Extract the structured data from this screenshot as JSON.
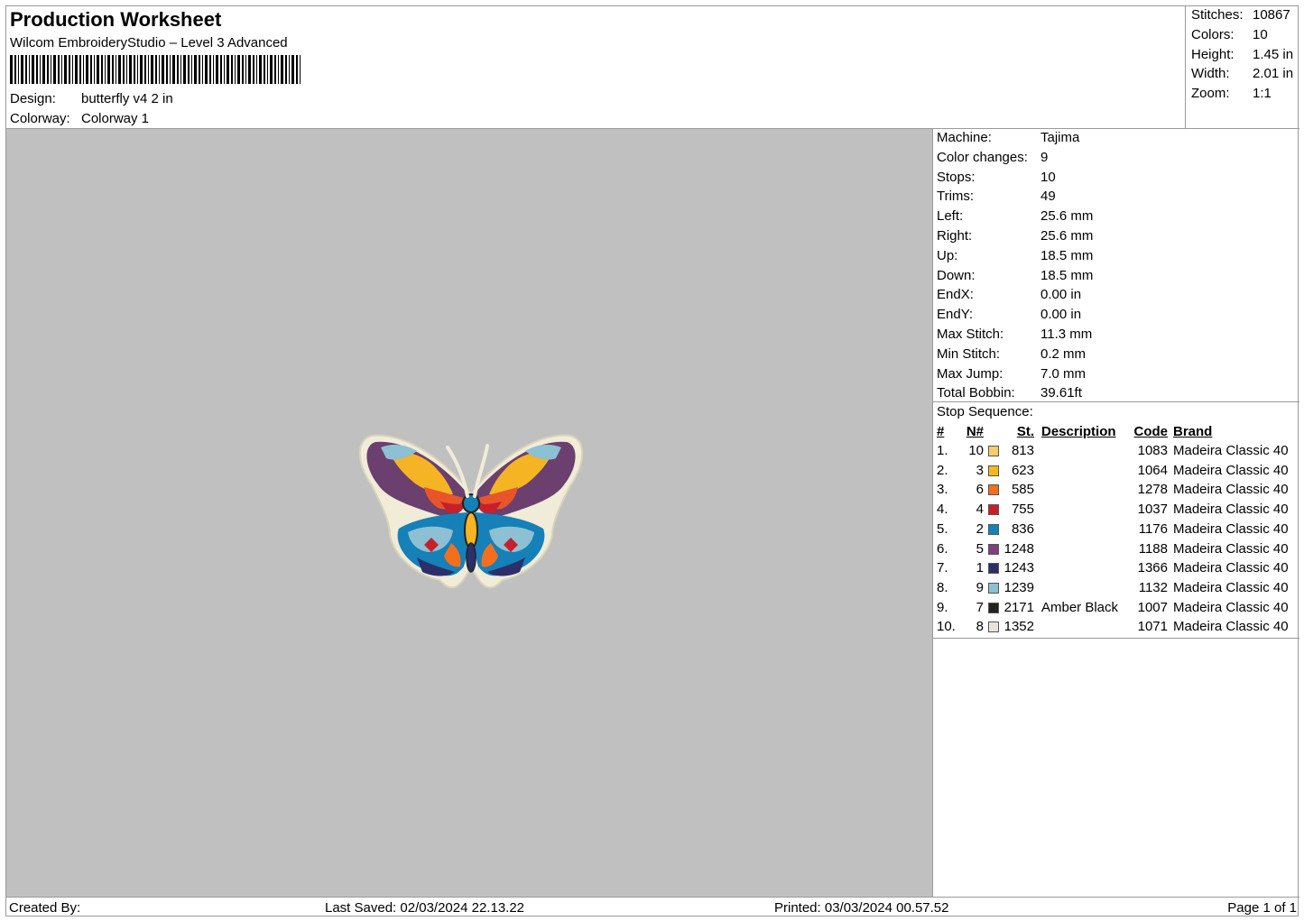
{
  "header": {
    "title": "Production Worksheet",
    "subtitle": "Wilcom EmbroideryStudio – Level 3 Advanced",
    "design_label": "Design:",
    "design_value": "butterfly v4 2 in",
    "colorway_label": "Colorway:",
    "colorway_value": "Colorway 1"
  },
  "stats": [
    {
      "label": "Stitches:",
      "value": "10867"
    },
    {
      "label": "Colors:",
      "value": "10"
    },
    {
      "label": "Height:",
      "value": "1.45 in"
    },
    {
      "label": "Width:",
      "value": "2.01 in"
    },
    {
      "label": "Zoom:",
      "value": "1:1"
    }
  ],
  "machine": [
    {
      "label": "Machine:",
      "value": "Tajima"
    },
    {
      "label": "Color changes:",
      "value": "9"
    },
    {
      "label": "Stops:",
      "value": "10"
    },
    {
      "label": "Trims:",
      "value": "49"
    },
    {
      "label": "Left:",
      "value": "25.6 mm"
    },
    {
      "label": "Right:",
      "value": "25.6 mm"
    },
    {
      "label": "Up:",
      "value": "18.5 mm"
    },
    {
      "label": "Down:",
      "value": "18.5 mm"
    },
    {
      "label": "EndX:",
      "value": "0.00 in"
    },
    {
      "label": "EndY:",
      "value": "0.00 in"
    },
    {
      "label": "Max Stitch:",
      "value": "11.3 mm"
    },
    {
      "label": "Min Stitch:",
      "value": "0.2 mm"
    },
    {
      "label": "Max Jump:",
      "value": "7.0 mm"
    },
    {
      "label": "Total Bobbin:",
      "value": "39.61ft"
    }
  ],
  "stop_sequence": {
    "title": "Stop Sequence:",
    "headers": {
      "idx": "#",
      "n": "N#",
      "st": "St.",
      "desc": "Description",
      "code": "Code",
      "brand": "Brand"
    },
    "rows": [
      {
        "idx": "1.",
        "n": "10",
        "color": "#f7cc6a",
        "st": "813",
        "desc": "",
        "code": "1083",
        "brand": "Madeira Classic 40"
      },
      {
        "idx": "2.",
        "n": "3",
        "color": "#f5b91e",
        "st": "623",
        "desc": "",
        "code": "1064",
        "brand": "Madeira Classic 40"
      },
      {
        "idx": "3.",
        "n": "6",
        "color": "#f26f1d",
        "st": "585",
        "desc": "",
        "code": "1278",
        "brand": "Madeira Classic 40"
      },
      {
        "idx": "4.",
        "n": "4",
        "color": "#c8202a",
        "st": "755",
        "desc": "",
        "code": "1037",
        "brand": "Madeira Classic 40"
      },
      {
        "idx": "5.",
        "n": "2",
        "color": "#1680b8",
        "st": "836",
        "desc": "",
        "code": "1176",
        "brand": "Madeira Classic 40"
      },
      {
        "idx": "6.",
        "n": "5",
        "color": "#7d3f7e",
        "st": "1248",
        "desc": "",
        "code": "1188",
        "brand": "Madeira Classic 40"
      },
      {
        "idx": "7.",
        "n": "1",
        "color": "#2c2f6b",
        "st": "1243",
        "desc": "",
        "code": "1366",
        "brand": "Madeira Classic 40"
      },
      {
        "idx": "8.",
        "n": "9",
        "color": "#8cc0d2",
        "st": "1239",
        "desc": "",
        "code": "1132",
        "brand": "Madeira Classic 40"
      },
      {
        "idx": "9.",
        "n": "7",
        "color": "#222222",
        "st": "2171",
        "desc": "Amber Black",
        "code": "1007",
        "brand": "Madeira Classic 40"
      },
      {
        "idx": "10.",
        "n": "8",
        "color": "#e8e4da",
        "st": "1352",
        "desc": "",
        "code": "1071",
        "brand": "Madeira Classic 40"
      }
    ]
  },
  "footer": {
    "created_by": "Created By:",
    "last_saved": "Last Saved: 02/03/2024 22.13.22",
    "printed": "Printed: 03/03/2024 00.57.52",
    "page": "Page 1 of 1"
  }
}
